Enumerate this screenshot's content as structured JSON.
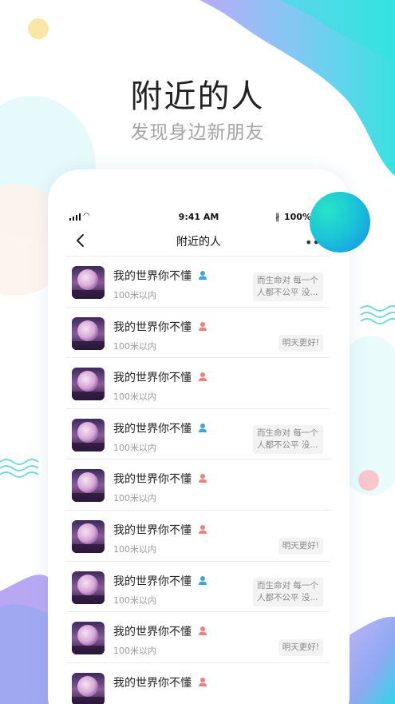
{
  "headline": {
    "title": "附近的人",
    "subtitle": "发现身边新朋友"
  },
  "status_bar": {
    "time": "9:41 AM",
    "battery": "100%"
  },
  "navbar": {
    "title": "附近的人"
  },
  "list": [
    {
      "name": "我的世界你不懂",
      "gender": "male",
      "distance": "100米以内",
      "signature": "而生命对 每一个人都不公平 没..."
    },
    {
      "name": "我的世界你不懂",
      "gender": "female",
      "distance": "100米以内",
      "signature": "明天更好!"
    },
    {
      "name": "我的世界你不懂",
      "gender": "female",
      "distance": "100米以内",
      "signature": ""
    },
    {
      "name": "我的世界你不懂",
      "gender": "male",
      "distance": "100米以内",
      "signature": "而生命对 每一个人都不公平 没..."
    },
    {
      "name": "我的世界你不懂",
      "gender": "female",
      "distance": "100米以内",
      "signature": ""
    },
    {
      "name": "我的世界你不懂",
      "gender": "female",
      "distance": "100米以内",
      "signature": "明天更好!"
    },
    {
      "name": "我的世界你不懂",
      "gender": "male",
      "distance": "100米以内",
      "signature": "而生命对 每一个人都不公平 没..."
    },
    {
      "name": "我的世界你不懂",
      "gender": "female",
      "distance": "100米以内",
      "signature": "明天更好!"
    },
    {
      "name": "我的世界你不懂",
      "gender": "female",
      "distance": "",
      "signature": ""
    }
  ],
  "colors": {
    "male": "#3aa6e0",
    "female": "#f07f7f"
  }
}
